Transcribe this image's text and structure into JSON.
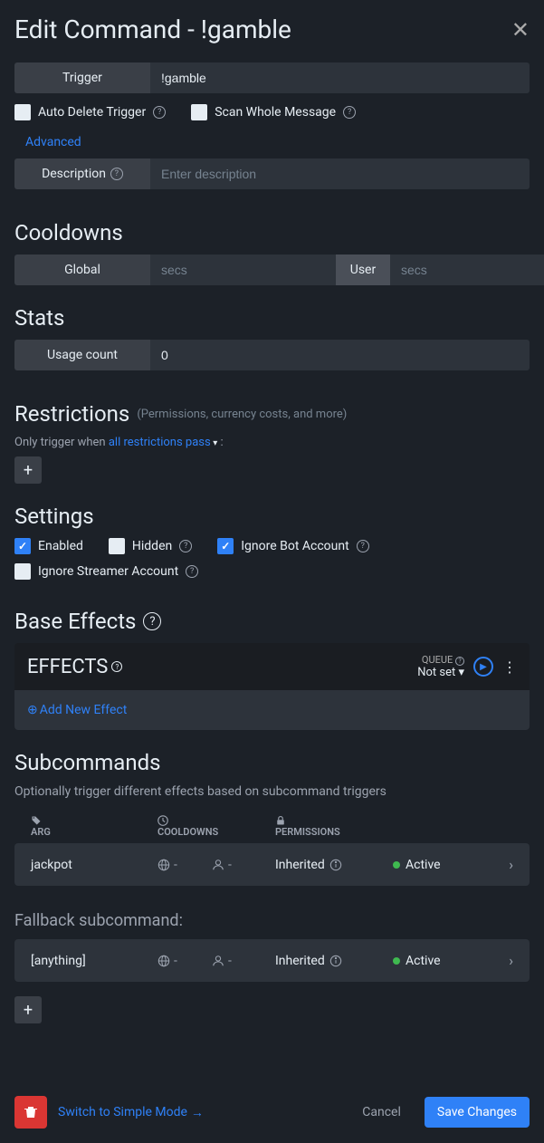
{
  "header": {
    "title": "Edit Command - !gamble"
  },
  "trigger": {
    "label": "Trigger",
    "value": "!gamble"
  },
  "autoDelete": {
    "label": "Auto Delete Trigger",
    "checked": false
  },
  "scanWhole": {
    "label": "Scan Whole Message",
    "checked": false
  },
  "advanced": "Advanced",
  "description": {
    "label": "Description",
    "placeholder": "Enter description",
    "value": ""
  },
  "cooldowns": {
    "title": "Cooldowns",
    "global": "Global",
    "user": "User",
    "placeholder": "secs"
  },
  "stats": {
    "title": "Stats",
    "usageLabel": "Usage count",
    "usageValue": "0"
  },
  "restrictions": {
    "title": "Restrictions",
    "hint": "(Permissions, currency costs, and more)",
    "line1": "Only trigger when",
    "link": "all restrictions pass",
    "colon": ":"
  },
  "settings": {
    "title": "Settings",
    "enabled": {
      "label": "Enabled",
      "checked": true
    },
    "hidden": {
      "label": "Hidden",
      "checked": false
    },
    "ignoreBot": {
      "label": "Ignore Bot Account",
      "checked": true
    },
    "ignoreStreamer": {
      "label": "Ignore Streamer Account",
      "checked": false
    }
  },
  "baseEffects": {
    "title": "Base Effects",
    "effectsLabel": "EFFECTS",
    "queue": "QUEUE",
    "notSet": "Not set",
    "addNew": "Add New Effect"
  },
  "subcommands": {
    "title": "Subcommands",
    "desc": "Optionally trigger different effects based on subcommand triggers",
    "headers": {
      "arg": "ARG",
      "cd": "COOLDOWNS",
      "perm": "PERMISSIONS"
    },
    "rows": [
      {
        "arg": "jackpot",
        "globalCd": "-",
        "userCd": "-",
        "perm": "Inherited",
        "status": "Active"
      }
    ],
    "fallbackTitle": "Fallback subcommand:",
    "fallback": {
      "arg": "[anything]",
      "globalCd": "-",
      "userCd": "-",
      "perm": "Inherited",
      "status": "Active"
    }
  },
  "footer": {
    "simple": "Switch to Simple Mode",
    "cancel": "Cancel",
    "save": "Save Changes"
  }
}
